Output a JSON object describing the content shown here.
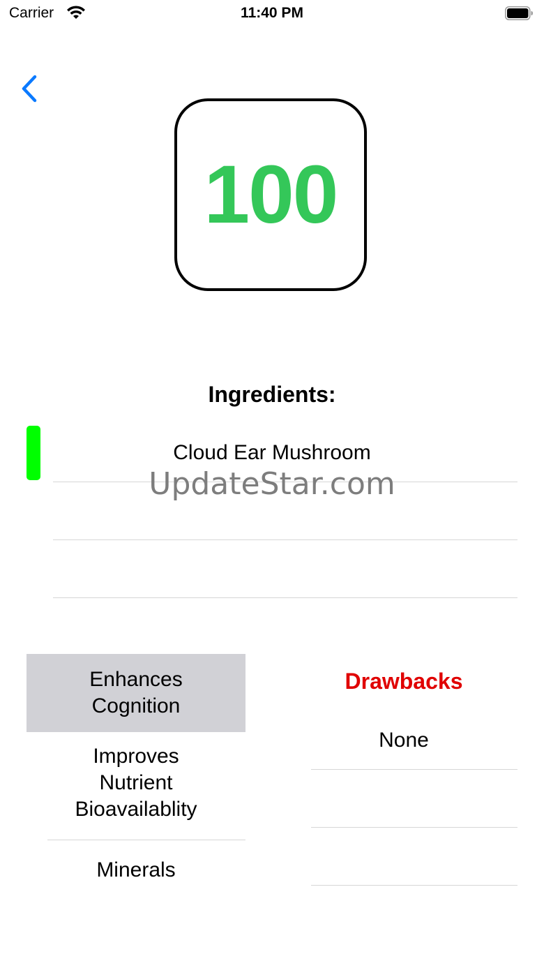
{
  "status_bar": {
    "carrier": "Carrier",
    "time": "11:40 PM"
  },
  "score": {
    "value": "100",
    "color": "#34c759"
  },
  "ingredients": {
    "title": "Ingredients:",
    "indicator_color": "#00ff00",
    "items": [
      "Cloud Ear Mushroom",
      "",
      ""
    ]
  },
  "watermark": "UpdateStar.com",
  "benefits": {
    "items": [
      {
        "label": "Enhances Cognition",
        "selected": true
      },
      {
        "label": "Improves Nutrient Bioavailablity",
        "selected": false
      },
      {
        "label": "Minerals",
        "selected": false
      }
    ]
  },
  "drawbacks": {
    "title": "Drawbacks",
    "color": "#e00000",
    "items": [
      "None",
      "",
      ""
    ]
  },
  "icons": {
    "back": "chevron-left-icon",
    "wifi": "wifi-icon",
    "battery": "battery-icon"
  }
}
